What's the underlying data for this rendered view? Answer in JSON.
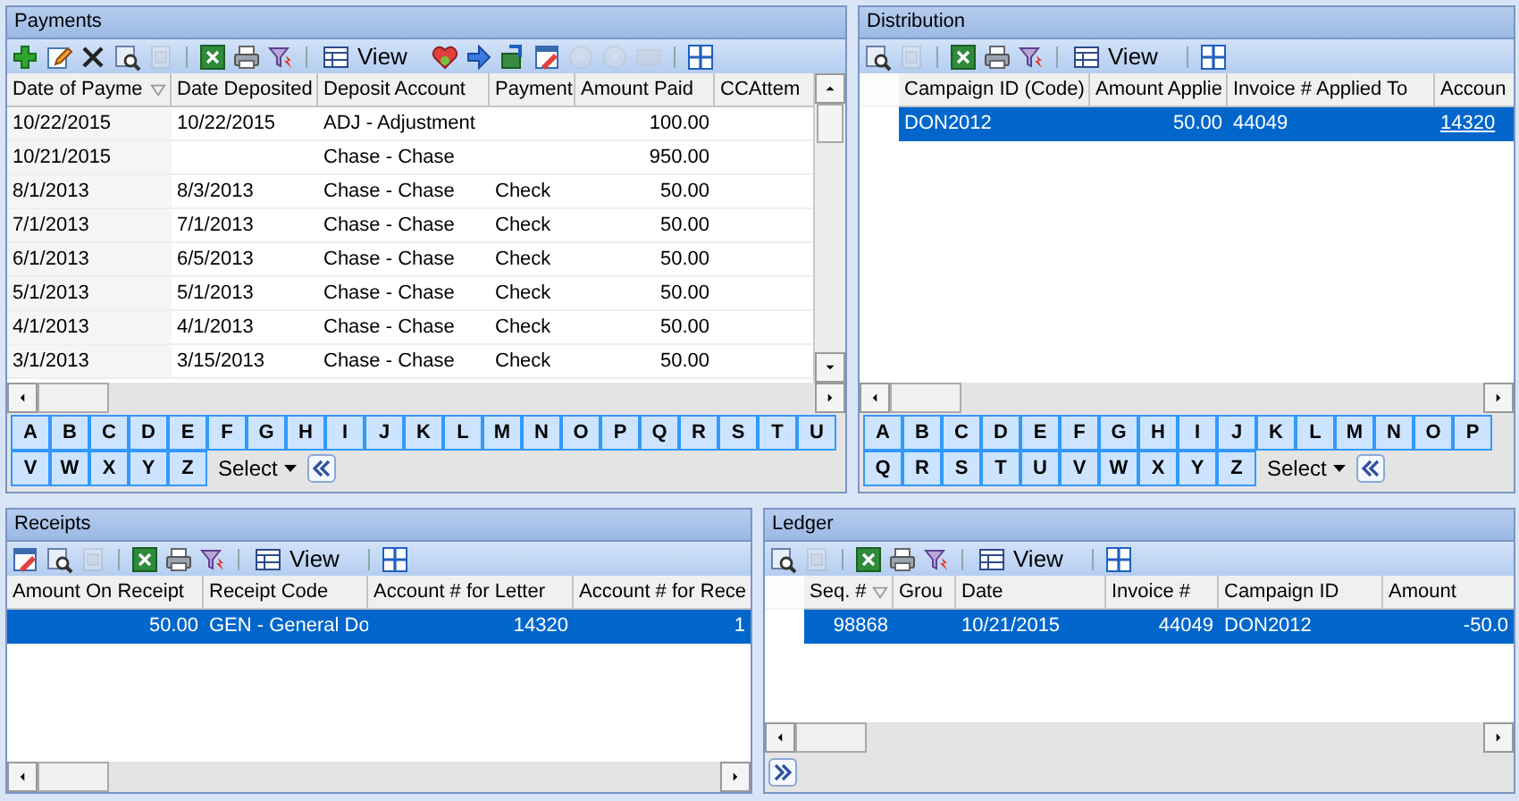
{
  "panels": [
    {
      "title": "Payments",
      "vertical_scrollbar": true,
      "tools": [
        {
          "kind": "add",
          "disabled": false
        },
        {
          "kind": "edit",
          "disabled": false
        },
        {
          "kind": "delete",
          "disabled": false
        },
        {
          "kind": "find",
          "disabled": false
        },
        {
          "kind": "preview",
          "disabled": true
        },
        {
          "kind": "separator"
        },
        {
          "kind": "excel",
          "disabled": false
        },
        {
          "kind": "print",
          "disabled": false
        },
        {
          "kind": "filter",
          "disabled": false
        },
        {
          "kind": "separator"
        },
        {
          "kind": "view",
          "label": "View"
        },
        {
          "kind": "heart",
          "disabled": false
        },
        {
          "kind": "arrow",
          "disabled": false
        },
        {
          "kind": "export",
          "disabled": false
        },
        {
          "kind": "calendar",
          "disabled": false
        },
        {
          "kind": "disc",
          "disabled": true
        },
        {
          "kind": "disc",
          "disabled": true
        },
        {
          "kind": "card",
          "disabled": true
        },
        {
          "kind": "separator"
        },
        {
          "kind": "layout",
          "disabled": false
        }
      ],
      "columns": [
        {
          "label": "Date of Payme",
          "sorted": true,
          "kind": "text"
        },
        {
          "label": "Date Deposited",
          "sorted": false,
          "kind": "text"
        },
        {
          "label": "Deposit Account",
          "sorted": false,
          "kind": "text"
        },
        {
          "label": "Payment",
          "sorted": false,
          "kind": "text"
        },
        {
          "label": "Amount Paid",
          "sorted": false,
          "kind": "number"
        },
        {
          "label": "CCAttem",
          "sorted": false,
          "kind": "text"
        }
      ],
      "rows": [
        {
          "selected": false,
          "cells": [
            "10/22/2015",
            "10/22/2015",
            "ADJ - Adjustment",
            null,
            "100.00",
            null
          ]
        },
        {
          "selected": false,
          "cells": [
            "10/21/2015",
            null,
            "Chase - Chase",
            null,
            "950.00",
            null
          ]
        },
        {
          "selected": false,
          "cells": [
            "8/1/2013",
            "8/3/2013",
            "Chase - Chase",
            "Check",
            "50.00",
            null
          ]
        },
        {
          "selected": false,
          "cells": [
            "7/1/2013",
            "7/1/2013",
            "Chase - Chase",
            "Check",
            "50.00",
            null
          ]
        },
        {
          "selected": false,
          "cells": [
            "6/1/2013",
            "6/5/2013",
            "Chase - Chase",
            "Check",
            "50.00",
            null
          ]
        },
        {
          "selected": false,
          "cells": [
            "5/1/2013",
            "5/1/2013",
            "Chase - Chase",
            "Check",
            "50.00",
            null
          ]
        },
        {
          "selected": false,
          "cells": [
            "4/1/2013",
            "4/1/2013",
            "Chase - Chase",
            "Check",
            "50.00",
            null
          ]
        },
        {
          "selected": false,
          "cells": [
            "3/1/2013",
            "3/15/2013",
            "Chase - Chase",
            "Check",
            "50.00",
            null
          ]
        }
      ],
      "alpha_bar": {
        "expanded": true,
        "letters": [
          "A",
          "B",
          "C",
          "D",
          "E",
          "F",
          "G",
          "H",
          "I",
          "J",
          "K",
          "L",
          "M",
          "N",
          "O",
          "P",
          "Q",
          "R",
          "S",
          "T",
          "U",
          "V",
          "W",
          "X",
          "Y",
          "Z"
        ],
        "select_label": "Select"
      }
    },
    {
      "title": "Distribution",
      "row_indicator": true,
      "tools": [
        {
          "kind": "find",
          "disabled": false
        },
        {
          "kind": "preview",
          "disabled": true
        },
        {
          "kind": "separator"
        },
        {
          "kind": "excel",
          "disabled": false
        },
        {
          "kind": "print",
          "disabled": false
        },
        {
          "kind": "filter",
          "disabled": false
        },
        {
          "kind": "separator"
        },
        {
          "kind": "view",
          "label": "View"
        },
        {
          "kind": "separator"
        },
        {
          "kind": "layout",
          "disabled": false
        }
      ],
      "columns": [
        {
          "label": "Campaign ID (Code)",
          "sorted": false,
          "kind": "text"
        },
        {
          "label": "Amount Applie",
          "sorted": false,
          "kind": "number"
        },
        {
          "label": "Invoice # Applied To",
          "sorted": false,
          "kind": "text"
        },
        {
          "label": "Accoun",
          "sorted": false,
          "kind": "link"
        }
      ],
      "rows": [
        {
          "selected": true,
          "cells": [
            "DON2012",
            "50.00",
            "44049",
            "14320"
          ]
        }
      ],
      "alpha_bar": {
        "expanded": true,
        "letters": [
          "A",
          "B",
          "C",
          "D",
          "E",
          "F",
          "G",
          "H",
          "I",
          "J",
          "K",
          "L",
          "M",
          "N",
          "O",
          "P",
          "Q",
          "R",
          "S",
          "T",
          "U",
          "V",
          "W",
          "X",
          "Y",
          "Z"
        ],
        "select_label": "Select"
      }
    },
    {
      "title": "Receipts",
      "tools": [
        {
          "kind": "calendar",
          "disabled": false
        },
        {
          "kind": "find",
          "disabled": false
        },
        {
          "kind": "preview",
          "disabled": true
        },
        {
          "kind": "separator"
        },
        {
          "kind": "excel",
          "disabled": false
        },
        {
          "kind": "print",
          "disabled": false
        },
        {
          "kind": "filter",
          "disabled": false
        },
        {
          "kind": "separator"
        },
        {
          "kind": "view",
          "label": "View"
        },
        {
          "kind": "separator"
        },
        {
          "kind": "layout",
          "disabled": false
        }
      ],
      "columns": [
        {
          "label": "Amount On Receipt",
          "sorted": false,
          "kind": "number"
        },
        {
          "label": "Receipt Code",
          "sorted": false,
          "kind": "text"
        },
        {
          "label": "Account # for Letter",
          "sorted": false,
          "kind": "number"
        },
        {
          "label": "Account # for Rece",
          "sorted": false,
          "kind": "number"
        }
      ],
      "rows": [
        {
          "selected": true,
          "cells": [
            "50.00",
            "GEN - General Do",
            "14320",
            "1"
          ]
        }
      ]
    },
    {
      "title": "Ledger",
      "row_indicator": true,
      "tools": [
        {
          "kind": "find",
          "disabled": false
        },
        {
          "kind": "preview",
          "disabled": true
        },
        {
          "kind": "separator"
        },
        {
          "kind": "excel",
          "disabled": false
        },
        {
          "kind": "print",
          "disabled": false
        },
        {
          "kind": "filter",
          "disabled": false
        },
        {
          "kind": "separator"
        },
        {
          "kind": "view",
          "label": "View"
        },
        {
          "kind": "separator"
        },
        {
          "kind": "layout",
          "disabled": false
        }
      ],
      "columns": [
        {
          "label": "Seq. #",
          "sorted": true,
          "kind": "number"
        },
        {
          "label": "Grou",
          "sorted": false,
          "kind": "text"
        },
        {
          "label": "Date",
          "sorted": false,
          "kind": "text"
        },
        {
          "label": "Invoice #",
          "sorted": false,
          "kind": "number"
        },
        {
          "label": "Campaign ID",
          "sorted": false,
          "kind": "text"
        },
        {
          "label": "Amount",
          "sorted": false,
          "kind": "number"
        }
      ],
      "rows": [
        {
          "selected": true,
          "cells": [
            "98868",
            null,
            "10/21/2015",
            "44049",
            "DON2012",
            "-50.0"
          ]
        }
      ],
      "alpha_bar": {
        "expanded": false
      }
    }
  ]
}
